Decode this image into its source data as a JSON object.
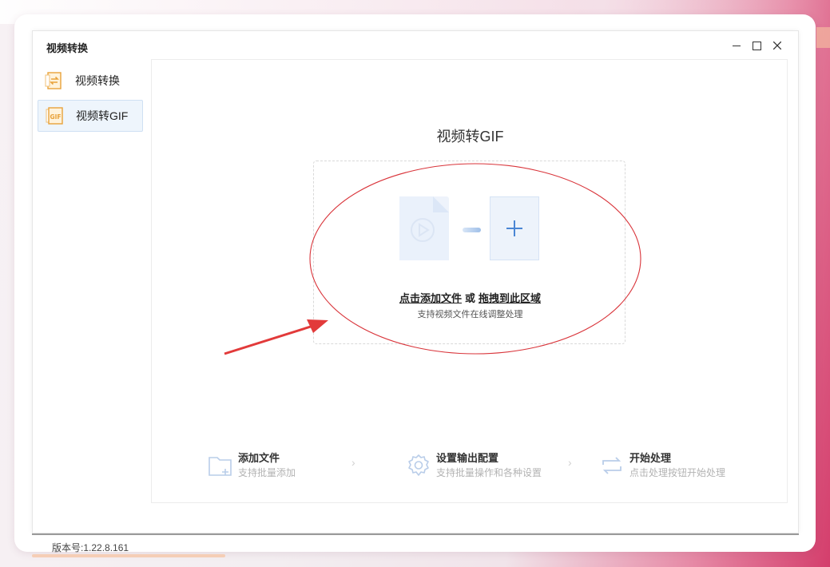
{
  "window": {
    "title": "视频转换",
    "controls": {
      "minimize": "minimize-icon",
      "maximize": "maximize-icon",
      "close": "close-icon"
    }
  },
  "sidebar": {
    "items": [
      {
        "label": "视频转换",
        "icon": "video-convert-icon",
        "active": false
      },
      {
        "label": "视频转GIF",
        "icon": "gif-icon",
        "active": true
      }
    ],
    "version": "版本号:1.22.8.161"
  },
  "main": {
    "title": "视频转GIF",
    "drop_zone": {
      "click_add": "点击添加文件",
      "or": "或",
      "drag_here": "拖拽到此区域",
      "subtitle": "支持视频文件在线调整处理"
    },
    "steps": [
      {
        "title": "添加文件",
        "desc": "支持批量添加",
        "icon": "folder-add-icon"
      },
      {
        "title": "设置输出配置",
        "desc": "支持批量操作和各种设置",
        "icon": "gear-icon"
      },
      {
        "title": "开始处理",
        "desc": "点击处理按钮开始处理",
        "icon": "repeat-icon"
      }
    ]
  },
  "colors": {
    "accent_blue": "#4a86d4",
    "icon_orange": "#e8a23a",
    "annotation_red": "#e03a3a"
  }
}
